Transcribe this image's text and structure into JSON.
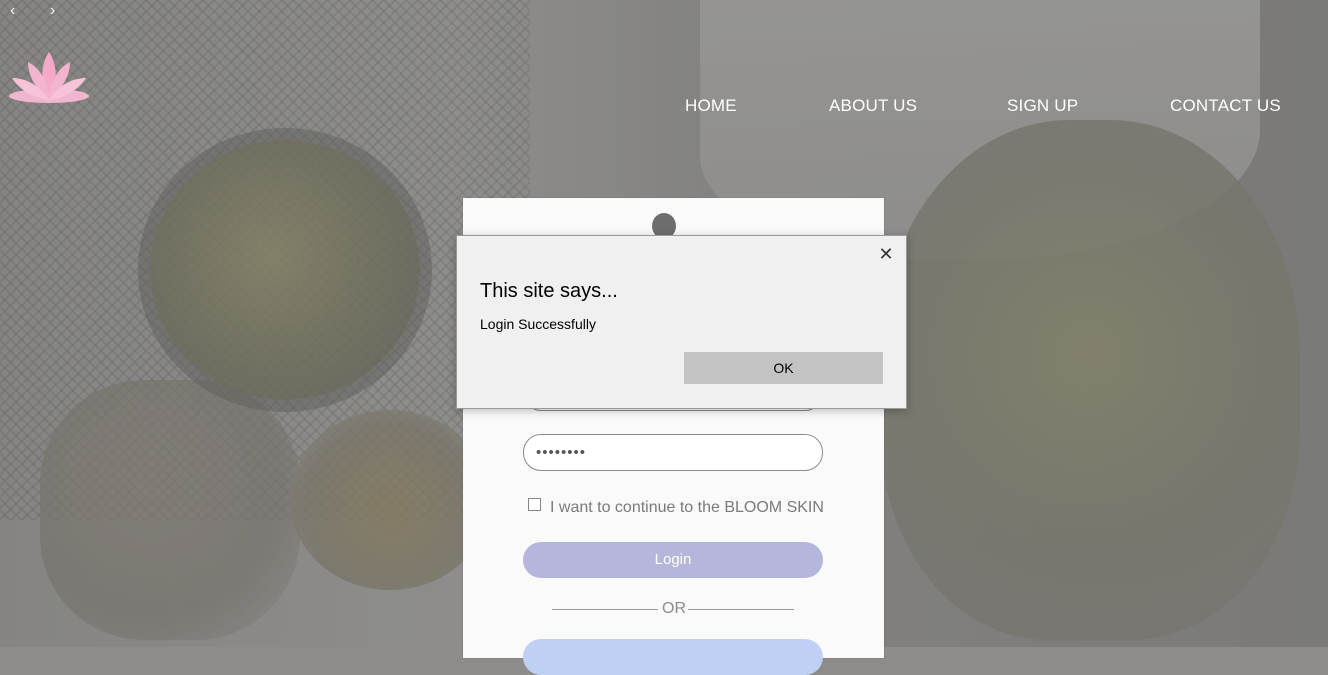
{
  "browser_nav": {
    "back_glyph": "‹",
    "forward_glyph": "›"
  },
  "logo": {
    "icon": "lotus-icon"
  },
  "nav": {
    "home": "HOME",
    "about": "ABOUT US",
    "signup": "SIGN UP",
    "contact": "CONTACT US"
  },
  "login_form": {
    "password_value": "••••••••",
    "remember_label": "I want to continue to the BLOOM SKIN",
    "login_button": "Login",
    "divider_text": "OR"
  },
  "dialog": {
    "title": "This site says...",
    "message": "Login Successfully",
    "ok_label": "OK",
    "close_glyph": "✕"
  },
  "colors": {
    "login_button": "#b6b5dc",
    "secondary_button": "#bfd0f4",
    "dialog_bg": "#f0f0f0"
  }
}
